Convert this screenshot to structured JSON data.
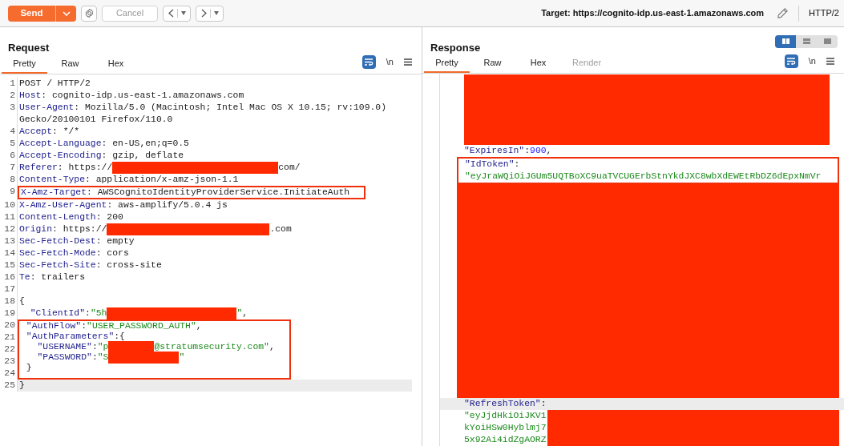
{
  "toolbar": {
    "send": "Send",
    "cancel": "Cancel",
    "target": "Target: https://cognito-idp.us-east-1.amazonaws.com",
    "protocol": "HTTP/2"
  },
  "request": {
    "title": "Request",
    "tabs": [
      {
        "label": "Pretty",
        "selected": true
      },
      {
        "label": "Raw",
        "selected": false
      },
      {
        "label": "Hex",
        "selected": false
      }
    ],
    "newline": "\\n",
    "lines": [
      {
        "n": "1",
        "current": false,
        "boxed": false,
        "segs": [
          {
            "kind": "text",
            "text": "POST / HTTP/2"
          }
        ]
      },
      {
        "n": "2",
        "current": false,
        "boxed": false,
        "segs": [
          {
            "kind": "key",
            "text": "Host"
          },
          {
            "kind": "text",
            "text": ": cognito-idp.us-east-1.amazonaws.com"
          }
        ]
      },
      {
        "n": "3",
        "current": false,
        "boxed": false,
        "segs": [
          {
            "kind": "key",
            "text": "User-Agent"
          },
          {
            "kind": "text",
            "text": ": Mozilla/5.0 (Macintosh; Intel Mac OS X 10.15; rv:109.0) Gecko/20100101 Firefox/110.0"
          }
        ]
      },
      {
        "n": "4",
        "current": false,
        "boxed": false,
        "segs": [
          {
            "kind": "key",
            "text": "Accept"
          },
          {
            "kind": "text",
            "text": ": */*"
          }
        ]
      },
      {
        "n": "5",
        "current": false,
        "boxed": false,
        "segs": [
          {
            "kind": "key",
            "text": "Accept-Language"
          },
          {
            "kind": "text",
            "text": ": en-US,en;q=0.5"
          }
        ]
      },
      {
        "n": "6",
        "current": false,
        "boxed": false,
        "segs": [
          {
            "kind": "key",
            "text": "Accept-Encoding"
          },
          {
            "kind": "text",
            "text": ": gzip, deflate"
          }
        ]
      },
      {
        "n": "7",
        "current": false,
        "boxed": false,
        "segs": [
          {
            "kind": "key",
            "text": "Referer"
          },
          {
            "kind": "text",
            "text": ": https://"
          },
          {
            "kind": "redacted"
          },
          {
            "kind": "text",
            "text": "com/"
          }
        ]
      },
      {
        "n": "8",
        "current": false,
        "boxed": false,
        "segs": [
          {
            "kind": "key",
            "text": "Content-Type"
          },
          {
            "kind": "text",
            "text": ": application/x-amz-json-1.1"
          }
        ]
      },
      {
        "n": "9",
        "current": false,
        "boxed": true,
        "segs": [
          {
            "kind": "key",
            "text": "X-Amz-Target"
          },
          {
            "kind": "text",
            "text": ": AWSCognitoIdentityProviderService.InitiateAuth"
          }
        ]
      },
      {
        "n": "10",
        "current": false,
        "boxed": false,
        "segs": [
          {
            "kind": "key",
            "text": "X-Amz-User-Agent"
          },
          {
            "kind": "text",
            "text": ": aws-amplify/5.0.4 js"
          }
        ]
      },
      {
        "n": "11",
        "current": false,
        "boxed": false,
        "segs": [
          {
            "kind": "key",
            "text": "Content-Length"
          },
          {
            "kind": "text",
            "text": ": 200"
          }
        ]
      },
      {
        "n": "12",
        "current": false,
        "boxed": false,
        "segs": [
          {
            "kind": "key",
            "text": "Origin"
          },
          {
            "kind": "text",
            "text": ": https://"
          },
          {
            "kind": "redacted"
          },
          {
            "kind": "text",
            "text": ".com"
          }
        ]
      },
      {
        "n": "13",
        "current": false,
        "boxed": false,
        "segs": [
          {
            "kind": "key",
            "text": "Sec-Fetch-Dest"
          },
          {
            "kind": "text",
            "text": ": empty"
          }
        ]
      },
      {
        "n": "14",
        "current": false,
        "boxed": false,
        "segs": [
          {
            "kind": "key",
            "text": "Sec-Fetch-Mode"
          },
          {
            "kind": "text",
            "text": ": cors"
          }
        ]
      },
      {
        "n": "15",
        "current": false,
        "boxed": false,
        "segs": [
          {
            "kind": "key",
            "text": "Sec-Fetch-Site"
          },
          {
            "kind": "text",
            "text": ": cross-site"
          }
        ]
      },
      {
        "n": "16",
        "current": false,
        "boxed": false,
        "segs": [
          {
            "kind": "key",
            "text": "Te"
          },
          {
            "kind": "text",
            "text": ": trailers"
          }
        ]
      },
      {
        "n": "17",
        "current": false,
        "boxed": false
      },
      {
        "n": "18",
        "current": false,
        "boxed": false,
        "segs": [
          {
            "kind": "text",
            "text": "{"
          }
        ]
      },
      {
        "n": "19",
        "current": false,
        "boxed": false,
        "segs": [
          {
            "kind": "key",
            "text": "  \"ClientId\""
          },
          {
            "kind": "text",
            "text": ":"
          },
          {
            "kind": "str",
            "text": "\"5h"
          },
          {
            "kind": "redacted"
          },
          {
            "kind": "str",
            "text": "\""
          },
          {
            "kind": "text",
            "text": ","
          }
        ]
      },
      {
        "n": "20",
        "current": false,
        "boxed": true,
        "segs": [
          {
            "kind": "key",
            "text": " \"AuthFlow\""
          },
          {
            "kind": "text",
            "text": ":"
          },
          {
            "kind": "str",
            "text": "\"USER_PASSWORD_AUTH\""
          },
          {
            "kind": "text",
            "text": ","
          }
        ]
      },
      {
        "n": "21",
        "current": false,
        "boxed": true,
        "segs": [
          {
            "kind": "key",
            "text": " \"AuthParameters\""
          },
          {
            "kind": "text",
            "text": ":{"
          }
        ]
      },
      {
        "n": "22",
        "current": false,
        "boxed": true,
        "segs": [
          {
            "kind": "key",
            "text": "   \"USERNAME\""
          },
          {
            "kind": "text",
            "text": ":"
          },
          {
            "kind": "str",
            "text": "\"p"
          },
          {
            "kind": "redacted"
          },
          {
            "kind": "str",
            "text": "@stratumsecurity.com\""
          },
          {
            "kind": "text",
            "text": ","
          }
        ]
      },
      {
        "n": "23",
        "current": false,
        "boxed": true,
        "segs": [
          {
            "kind": "key",
            "text": "   \"PASSWORD\""
          },
          {
            "kind": "text",
            "text": ":"
          },
          {
            "kind": "str",
            "text": "\"S"
          },
          {
            "kind": "redacted"
          },
          {
            "kind": "str",
            "text": "\""
          }
        ]
      },
      {
        "n": "24",
        "current": false,
        "boxed": true,
        "segs": [
          {
            "kind": "text",
            "text": " }"
          }
        ]
      },
      {
        "n": "25",
        "current": true,
        "boxed": false,
        "segs": [
          {
            "kind": "text",
            "text": "}"
          }
        ]
      }
    ]
  },
  "response": {
    "title": "Response",
    "views": [
      {
        "selected": true
      },
      {
        "selected": false
      },
      {
        "selected": false
      }
    ],
    "tabs": [
      {
        "label": "Pretty",
        "selected": true,
        "disabled": false
      },
      {
        "label": "Raw",
        "selected": false,
        "disabled": false
      },
      {
        "label": "Hex",
        "selected": false,
        "disabled": false
      },
      {
        "label": "Render",
        "selected": false,
        "disabled": true
      }
    ],
    "newline": "\\n",
    "items": [
      {
        "kind": "redaction"
      },
      {
        "kind": "line",
        "current": false,
        "boxed": false,
        "segs": [
          {
            "kind": "key",
            "text": "\"ExpiresIn\""
          },
          {
            "kind": "text",
            "text": ":"
          },
          {
            "kind": "num",
            "text": "900"
          },
          {
            "kind": "text",
            "text": ","
          }
        ]
      },
      {
        "kind": "line",
        "current": false,
        "boxed": true,
        "segs": [
          {
            "kind": "key",
            "text": "\"IdToken\""
          },
          {
            "kind": "text",
            "text": ":"
          }
        ]
      },
      {
        "kind": "line",
        "current": false,
        "boxed": true,
        "segs": [
          {
            "kind": "str",
            "text": "\"eyJraWQiOiJGUm5UQTBoXC9uaTVCUGErbStnYkdJXC8wbXdEWEtRbDZ6dEpxNmVr"
          }
        ]
      },
      {
        "kind": "redaction"
      },
      {
        "kind": "line",
        "current": true,
        "boxed": false,
        "segs": [
          {
            "kind": "key",
            "text": "\"RefreshToken\""
          },
          {
            "kind": "text",
            "text": ":"
          }
        ]
      },
      {
        "kind": "line",
        "current": false,
        "boxed": false,
        "segs": [
          {
            "kind": "str",
            "text": "\"eyJjdHkiOiJKV1"
          }
        ]
      },
      {
        "kind": "line",
        "current": false,
        "boxed": false,
        "segs": [
          {
            "kind": "str",
            "text": "kYoiHSw0Hyblmj7"
          }
        ]
      },
      {
        "kind": "line",
        "current": false,
        "boxed": false,
        "segs": [
          {
            "kind": "str",
            "text": "5x92Ai4idZgAORZ"
          }
        ]
      }
    ]
  }
}
